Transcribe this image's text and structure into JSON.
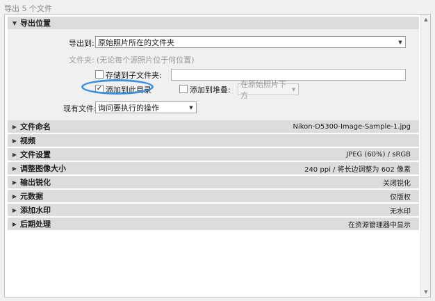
{
  "window": {
    "title": "导出 5 个文件"
  },
  "export_location": {
    "title": "导出位置",
    "export_to_label": "导出到:",
    "export_to_value": "原始照片所在的文件夹",
    "folder_label": "文件夹:",
    "folder_hint": "(无论每个源照片位于何位置)",
    "subfolder_label": "存储到子文件夹:",
    "subfolder_value": "",
    "add_to_catalog_label": "添加到此目录",
    "add_to_catalog_checked": true,
    "add_to_stack_label": "添加到堆叠:",
    "add_to_stack_checked": false,
    "stack_position_value": "在原始照片下方",
    "existing_files_label": "现有文件:",
    "existing_files_value": "询问要执行的操作"
  },
  "sections": [
    {
      "title": "文件命名",
      "summary": "Nikon-D5300-Image-Sample-1.jpg"
    },
    {
      "title": "视频",
      "summary": ""
    },
    {
      "title": "文件设置",
      "summary": "JPEG (60%) / sRGB"
    },
    {
      "title": "调整图像大小",
      "summary": "240 ppi / 将长边调整为 602 像素"
    },
    {
      "title": "输出锐化",
      "summary": "关闭锐化"
    },
    {
      "title": "元数据",
      "summary": "仅版权"
    },
    {
      "title": "添加水印",
      "summary": "无水印"
    },
    {
      "title": "后期处理",
      "summary": "在资源管理器中显示"
    }
  ],
  "icons": {
    "expanded": "triangle-down",
    "collapsed": "triangle-right",
    "highlight_color": "#3b8fdc"
  }
}
